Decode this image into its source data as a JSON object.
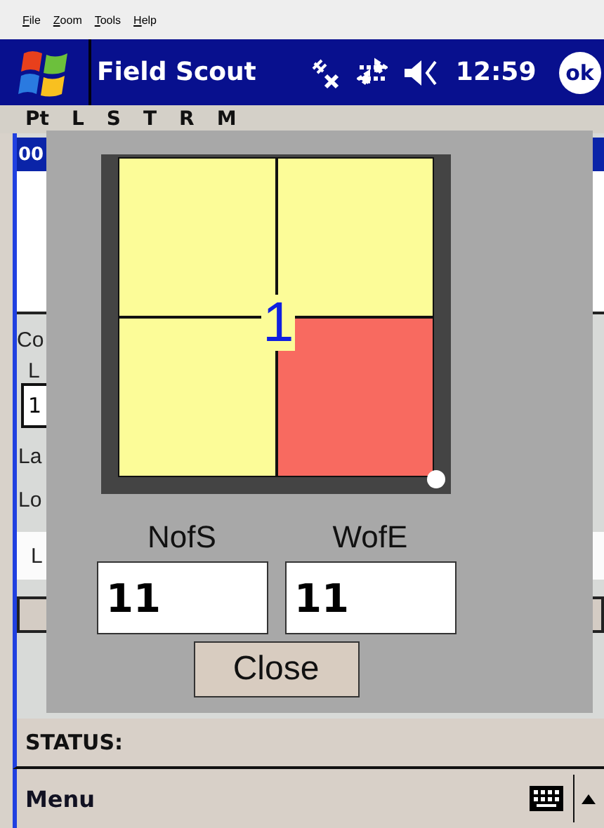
{
  "menu_bar": [
    {
      "label": "File"
    },
    {
      "label": "Zoom"
    },
    {
      "label": "Tools"
    },
    {
      "label": "Help"
    }
  ],
  "title_bar": {
    "title": "Field Scout",
    "time": "12:59",
    "ok": "ok"
  },
  "toolbar": [
    "Pt",
    "L",
    "S",
    "T",
    "R",
    "M"
  ],
  "form": {
    "selected_row": "00",
    "labels": [
      "Co",
      "L",
      "La",
      "Lo"
    ],
    "field_value": "1",
    "list_label": "L"
  },
  "dialog": {
    "quadrants": [
      {
        "color": "#fcfc98"
      },
      {
        "color": "#fcfc98"
      },
      {
        "color": "#fcfc98"
      },
      {
        "color": "#f86a60"
      }
    ],
    "marker": "1",
    "fields": [
      {
        "label": "NofS",
        "value": "11"
      },
      {
        "label": "WofE",
        "value": "11"
      }
    ],
    "button": "Close"
  },
  "status": "STATUS:",
  "bottom_bar": {
    "menu": "Menu"
  }
}
